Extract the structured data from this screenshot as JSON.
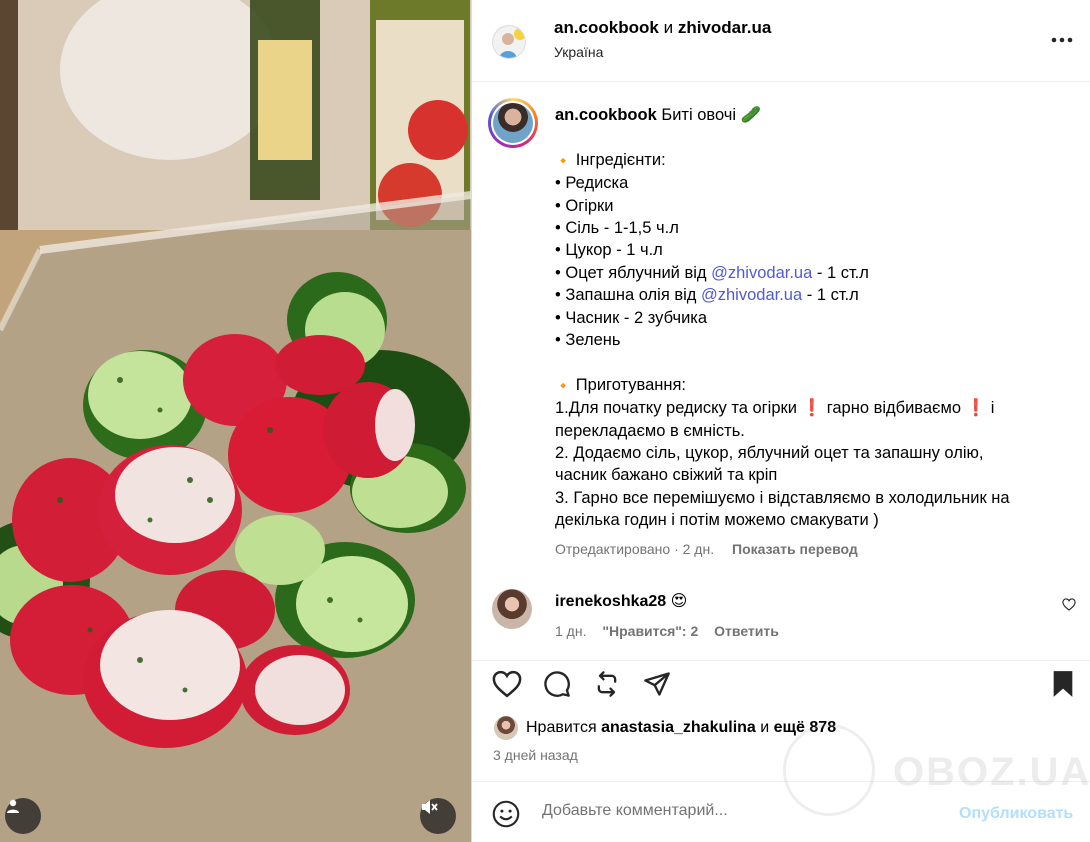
{
  "post": {
    "header": {
      "author1": "an.cookbook",
      "conjunction": "и",
      "author2": "zhivodar.ua",
      "location": "Україна"
    },
    "caption": {
      "user": "an.cookbook",
      "title": "Биті овочі 🥒",
      "ingredients_heading": "Інгредієнти:",
      "ing1": "• Редиска",
      "ing2": "• Огірки",
      "ing3": "• Сіль - 1-1,5 ч.л",
      "ing4": "• Цукор - 1 ч.л",
      "ing5_pre": "• Оцет яблучний від ",
      "ing5_mention": "@zhivodar.ua",
      "ing5_post": " - 1 ст.л",
      "ing6_pre": "• Запашна олія від ",
      "ing6_mention": "@zhivodar.ua",
      "ing6_post": " - 1 ст.л",
      "ing7": "• Часник - 2 зубчика",
      "ing8": "• Зелень",
      "prep_heading": "Приготування:",
      "step1a": "1.Для початку редиску та огірки ",
      "step1b": " гарно відбиваємо ",
      "step1c": " і",
      "step1d": "перекладаємо в ємність.",
      "step2a": "2. Додаємо сіль, цукор, яблучний оцет та запашну олію,",
      "step2b": "часник бажано свіжий та кріп",
      "step3a": "3. Гарно все перемішуємо і відставляємо в холодильник на",
      "step3b": "декілька годин і потім можемо смакувати )",
      "diamond": "🔸",
      "exclaim": "❗"
    },
    "meta": {
      "edited": "Отредактировано · 2 дн.",
      "translate": "Показать перевод"
    },
    "comment": {
      "user": "irenekoshka28",
      "emoji": "😍",
      "age": "1 дн.",
      "likes": "\"Нравится\": 2",
      "reply": "Ответить"
    },
    "likes": {
      "prefix": "Нравится",
      "user": "anastasia_zhakulina",
      "middle": "и",
      "count": "ещё 878"
    },
    "posted": "3 дней назад",
    "add_comment": {
      "placeholder": "Добавьте комментарий...",
      "publish": "Опубликовать"
    },
    "watermark": "OBOZ.UA"
  },
  "colors": {
    "mention": "#4f5bd5",
    "secondary_text": "#737373",
    "publish_disabled": "#b2dffc",
    "border": "#dbdbdb"
  },
  "icons": {
    "header": [
      "more-options-icon"
    ],
    "actions": [
      "heart-icon",
      "comment-icon",
      "repost-icon",
      "share-icon",
      "bookmark-icon"
    ],
    "media": [
      "user-tag-icon",
      "mute-icon"
    ],
    "composer": [
      "emoji-icon"
    ]
  }
}
